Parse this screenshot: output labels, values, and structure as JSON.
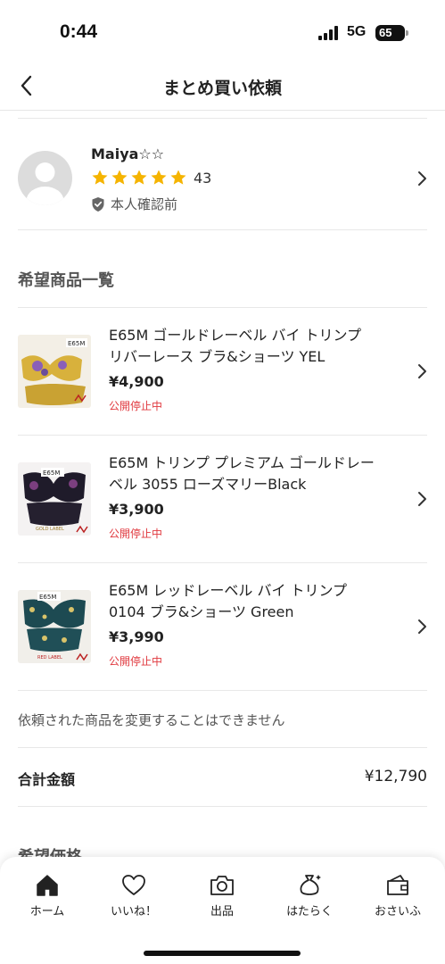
{
  "status": {
    "time": "0:44",
    "network": "5G",
    "battery": "65"
  },
  "header": {
    "title": "まとめ買い依頼"
  },
  "seller": {
    "name": "Maiya☆☆",
    "rating_stars": 5,
    "rating_count": "43",
    "verification": "本人確認前"
  },
  "section_title": "希望商品一覧",
  "items": [
    {
      "title": "E65M ゴールドレーベル バイ トリンプ リバーレース ブラ&ショーツ YEL",
      "price": "¥4,900",
      "status": "公開停止中"
    },
    {
      "title": "E65M トリンプ プレミアム ゴールドレーベル 3055 ローズマリーBlack",
      "price": "¥3,900",
      "status": "公開停止中"
    },
    {
      "title": "E65M レッドレーベル バイ トリンプ 0104 ブラ&ショーツ Green",
      "price": "¥3,990",
      "status": "公開停止中"
    }
  ],
  "notice": "依頼された商品を変更することはできません",
  "total": {
    "label": "合計金額",
    "value": "¥12,790"
  },
  "desired_price_title": "希望価格",
  "tabs": [
    {
      "label": "ホーム",
      "icon": "home-icon"
    },
    {
      "label": "いいね！",
      "icon": "heart-icon"
    },
    {
      "label": "出品",
      "icon": "camera-icon"
    },
    {
      "label": "はたらく",
      "icon": "money-bag-icon"
    },
    {
      "label": "おさいふ",
      "icon": "wallet-icon"
    }
  ],
  "colors": {
    "star": "#f5b400",
    "status_red": "#e0383e",
    "text": "#222222"
  }
}
